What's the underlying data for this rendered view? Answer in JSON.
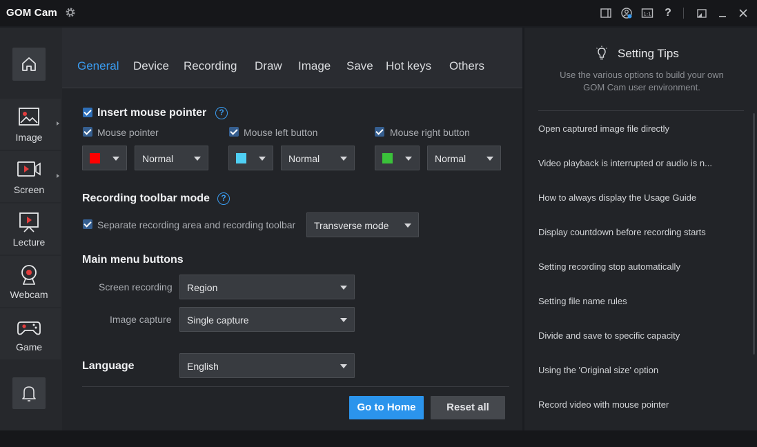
{
  "app": {
    "title": "GOM Cam",
    "accent": "#2b94ec"
  },
  "titlebar": {
    "icons": [
      "settings-gear-icon",
      "window-mode-icon",
      "account-icon",
      "screen-ratio-icon",
      "help-icon",
      "restore-icon",
      "minimize-icon",
      "close-icon"
    ],
    "help_label": "?"
  },
  "leftnav": {
    "items": [
      {
        "label": "Image",
        "icon": "image-icon"
      },
      {
        "label": "Screen",
        "icon": "screen-record-icon"
      },
      {
        "label": "Lecture",
        "icon": "lecture-icon"
      },
      {
        "label": "Webcam",
        "icon": "webcam-icon"
      },
      {
        "label": "Game",
        "icon": "gamepad-icon"
      }
    ]
  },
  "tabs": [
    {
      "label": "General",
      "active": true
    },
    {
      "label": "Device",
      "active": false
    },
    {
      "label": "Recording",
      "active": false
    },
    {
      "label": "Draw",
      "active": false
    },
    {
      "label": "Image",
      "active": false
    },
    {
      "label": "Save",
      "active": false
    },
    {
      "label": "Hot keys",
      "active": false
    },
    {
      "label": "Others",
      "active": false
    }
  ],
  "mouse": {
    "title": "Insert mouse pointer",
    "help": "?",
    "pointer": {
      "label": "Mouse pointer",
      "color": "#ff0000",
      "mode": "Normal"
    },
    "left": {
      "label": "Mouse left button",
      "color": "#4fd0f5",
      "mode": "Normal"
    },
    "right": {
      "label": "Mouse right button",
      "color": "#3ac23a",
      "mode": "Normal"
    }
  },
  "toolbar_mode": {
    "title": "Recording toolbar mode",
    "help": "?",
    "option_label": "Separate recording area and recording toolbar",
    "mode": "Transverse mode"
  },
  "main_menu": {
    "title": "Main menu buttons",
    "screen_recording_label": "Screen recording",
    "screen_recording_value": "Region",
    "image_capture_label": "Image capture",
    "image_capture_value": "Single capture"
  },
  "language": {
    "title": "Language",
    "value": "English"
  },
  "buttons": {
    "go_home": "Go to Home",
    "reset_all": "Reset all"
  },
  "tips": {
    "title": "Setting Tips",
    "subtitle_line1": "Use the various options to build your own",
    "subtitle_line2": "GOM Cam user environment.",
    "items": [
      "Open captured image file directly",
      "Video playback is interrupted or audio is n...",
      "How to always display the Usage Guide",
      "Display countdown before recording starts",
      "Setting recording stop automatically",
      "Setting file name rules",
      "Divide and save to specific capacity",
      "Using the 'Original size' option",
      "Record video with mouse pointer"
    ]
  }
}
